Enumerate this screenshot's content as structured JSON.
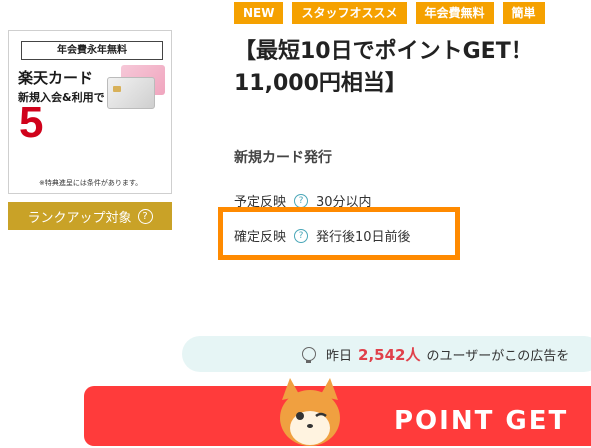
{
  "banner": {
    "fee_label": "年会費永年無料",
    "title": "楽天カード",
    "subtitle": "新規入会&利用で",
    "big_number": "5",
    "note": "※特典進呈には条件があります。"
  },
  "rank_button": {
    "label": "ランクアップ対象",
    "icon": "question-circle-icon"
  },
  "tags": [
    "NEW",
    "スタッフオススメ",
    "年会費無料",
    "簡単"
  ],
  "offer": {
    "title_line1": "【最短10日でポイントGET！",
    "title_line2": "11,000円相当】"
  },
  "condition": {
    "heading": "新規カード発行",
    "rows": [
      {
        "label": "予定反映",
        "value": "30分以内"
      },
      {
        "label": "確定反映",
        "value": "発行後10日前後"
      }
    ]
  },
  "users": {
    "prefix": "昨日",
    "count": "2,542人",
    "suffix": "のユーザーがこの広告を"
  },
  "cta": {
    "label": "POINT GET"
  },
  "colors": {
    "tag": "#f5a100",
    "highlight": "#ff8a00",
    "cta": "#ff3b3b",
    "rank": "#c9a227"
  }
}
